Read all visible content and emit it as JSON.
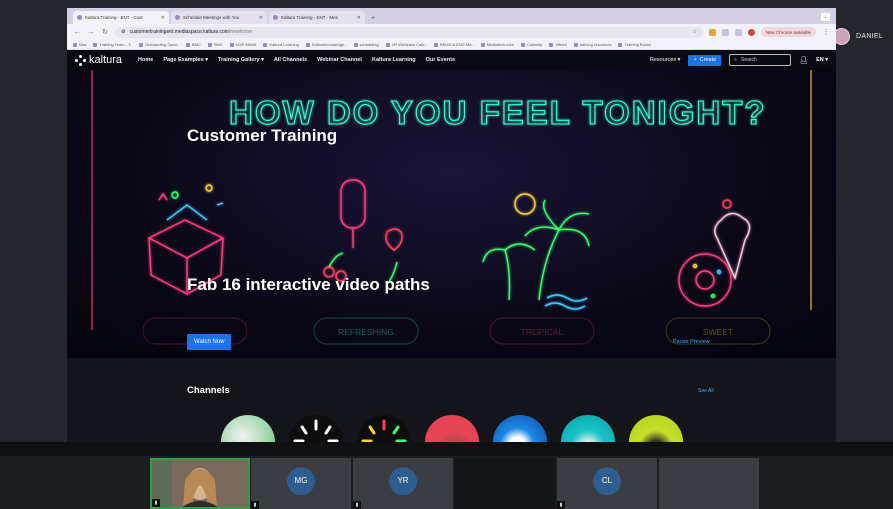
{
  "meeting": {
    "host_name": "DANIEL",
    "participants": [
      "MG",
      "YR",
      "CL"
    ]
  },
  "browser": {
    "tabs": [
      {
        "label": "Kaltura Training - ENT - Cust",
        "active": true
      },
      {
        "label": "Schedule Meetings with You",
        "active": false
      },
      {
        "label": "Kaltura Training - ENT - Mes",
        "active": false
      }
    ],
    "new_tab": "+",
    "url_host": "customertrainingent.mediaspace.kaltura.com",
    "url_path": "/newhome",
    "update_chip": "New Chrome available",
    "bookmarks": [
      "Nira",
      "Training Team - T..",
      "Onboarding Gami..",
      "BMC",
      "SMS",
      "KMS 5DMK",
      "Kaltura Learning",
      "KalturaKnowledge..",
      "scheduling",
      "VR Webinars Cale..",
      "REMS & ENG Ma..",
      "Mediatech.com",
      "Calendly",
      "Vifeed",
      "training resources",
      "Training Books"
    ]
  },
  "site": {
    "logo": "kaltura",
    "nav": [
      "Home",
      "Page Examples ▾",
      "Training Gallery ▾",
      "All Channels",
      "Webinar Channel",
      "Kaltura Learning",
      "Our Events"
    ],
    "resources": "Resources ▾",
    "create": "Create",
    "search_placeholder": "Search",
    "lang": "EN ▾",
    "hero_title": "Customer Training",
    "neon_heading": "HOW DO YOU FEEL TONIGHT?",
    "neon_labels": [
      "REFRESHING",
      "TROPICAL",
      "SWEET"
    ],
    "slide_heading": "Fab 16 interactive video paths",
    "watch_now": "Watch Now",
    "pause_preview": "Pause Preview",
    "slide_count": 8,
    "active_slide": 3,
    "channels_title": "Channels",
    "see_all": "See All"
  },
  "colors": {
    "accent_blue": "#1a73e8",
    "neon_pink": "#ff3d7f",
    "neon_green": "#39ff6a",
    "neon_yellow": "#ffd23a",
    "speaking_border": "#2ea043"
  }
}
